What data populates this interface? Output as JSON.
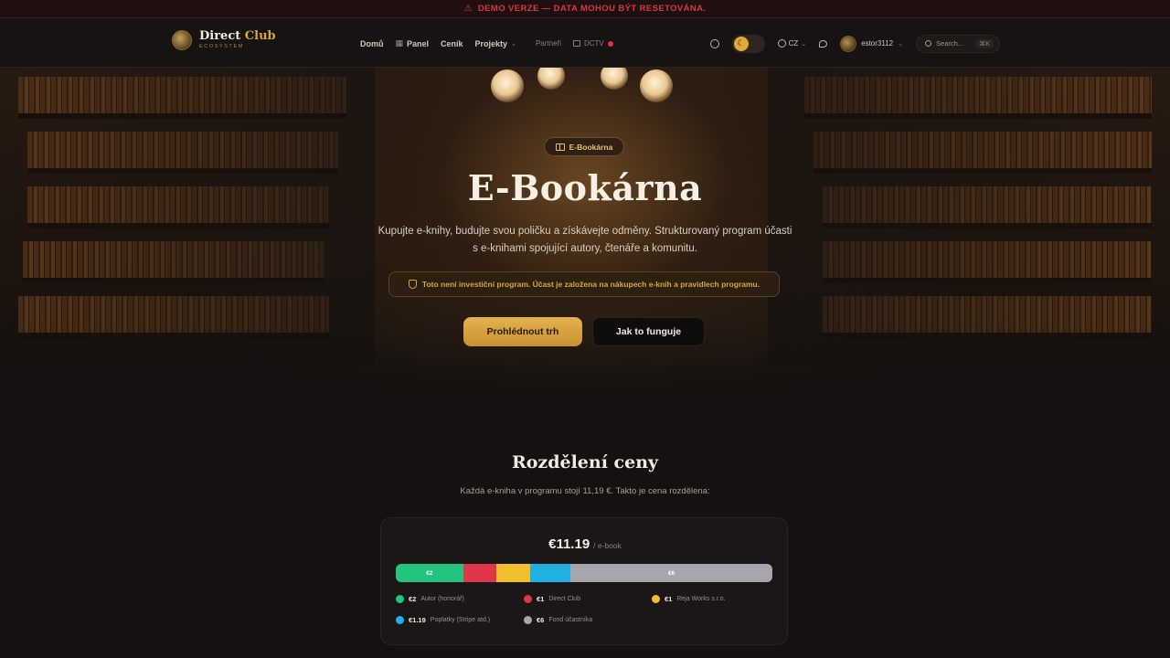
{
  "demo_banner": {
    "icon": "warning-icon",
    "text": "DEMO VERZE — DATA MOHOU BÝT RESETOVÁNA."
  },
  "logo": {
    "title_main": "Direct",
    "title_accent": "Club",
    "subtitle": "ECOSYSTEM"
  },
  "nav": {
    "home": "Domů",
    "panel": "Panel",
    "pricing": "Ceník",
    "projects": "Projekty",
    "partners": "Partneři",
    "dctv": "DCTV"
  },
  "header_right": {
    "language": "CZ",
    "username": "estor3112",
    "search_placeholder": "Search...",
    "search_shortcut": "⌘K"
  },
  "hero": {
    "badge": "E-Bookárna",
    "title": "E-Bookárna",
    "description": "Kupujte e-knihy, budujte svou poličku a získávejte odměny. Strukturovaný program účasti s e-knihami spojující autory, čtenáře a komunitu.",
    "notice": "Toto není investiční program. Účast je založena na nákupech e-knih a pravidlech programu.",
    "primary_button": "Prohlédnout trh",
    "secondary_button": "Jak to funguje"
  },
  "price_split": {
    "title": "Rozdělení ceny",
    "subtitle": "Každá e-kniha v programu stojí 11,19 €. Takto je cena rozdělena:",
    "price": "€11.19",
    "unit": "/ e-book",
    "segments": [
      {
        "name": "Autor (honorář)",
        "label": "€2",
        "bar_label": "€2",
        "value": 2,
        "color": "#22c47e"
      },
      {
        "name": "Direct Club",
        "label": "€1",
        "bar_label": "",
        "value": 1,
        "color": "#e0364a"
      },
      {
        "name": "Reja Works s.r.o.",
        "label": "€1",
        "bar_label": "",
        "value": 1,
        "color": "#f2bf2c"
      },
      {
        "name": "Poplatky (Stripe atd.)",
        "label": "€1.19",
        "bar_label": "",
        "value": 1.19,
        "color": "#1fb0e4"
      },
      {
        "name": "Fond účastníka",
        "label": "€6",
        "bar_label": "€6",
        "value": 6,
        "color": "#a7a6ae"
      }
    ]
  }
}
